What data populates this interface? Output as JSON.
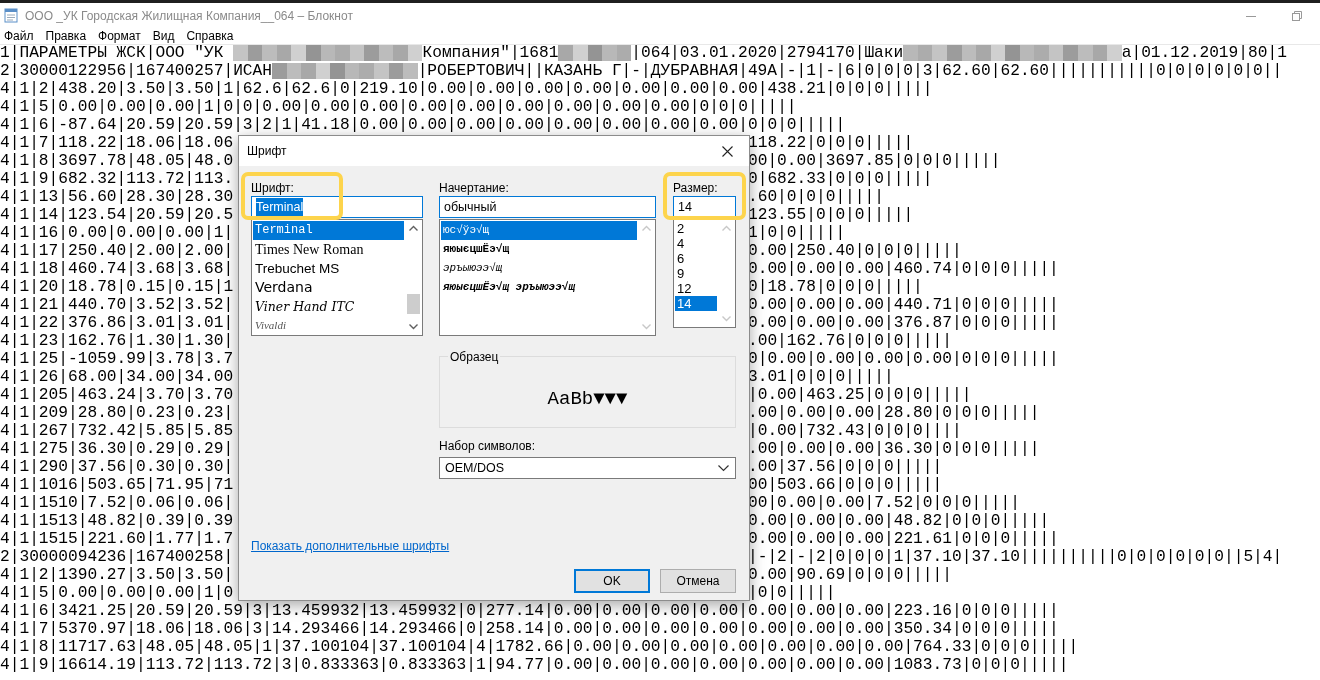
{
  "window": {
    "title": "ООО _УК Городская Жилищная Компания__064 – Блокнот",
    "menu": [
      "Файл",
      "Правка",
      "Формат",
      "Вид",
      "Справка"
    ]
  },
  "document": {
    "lines": [
      {
        "kind": "masked",
        "parts": [
          {
            "kind": "text",
            "text": "1|ПАРАМЕТРЫ ЖСК|ООО \"УК "
          },
          {
            "kind": "redacted"
          },
          {
            "kind": "text",
            "text": "Компания\"|1681"
          },
          {
            "kind": "redacted"
          },
          {
            "kind": "text",
            "text": "|064|03.01.2020|2794170|Шаки"
          },
          {
            "kind": "redacted"
          },
          {
            "kind": "text",
            "text": "а|01.12.2019|80|1"
          }
        ]
      },
      {
        "kind": "masked",
        "parts": [
          {
            "kind": "text",
            "text": "2|30000122956|167400257|ИСАН"
          },
          {
            "kind": "redacted"
          },
          {
            "kind": "text",
            "text": "|РОБЕРТОВИЧ||КАЗАНЬ Г|-|ДУБРАВНАЯ|49А|-|1|-|6|0|0|0|3|62.60|62.60|||||||||||0|0|0|0|0|0||"
          }
        ]
      },
      {
        "kind": "full",
        "text": "4|1|2|438.20|3.50|3.50|1|62.6|62.6|0|219.10|0.00|0.00|0.00|0.00|0.00|0.00|0.00|438.21|0|0|0|||||"
      },
      {
        "kind": "full",
        "text": "4|1|5|0.00|0.00|0.00|1|0|0|0.00|0.00|0.00|0.00|0.00|0.00|0.00|0.00|0.00|0|0|0|||||"
      },
      {
        "kind": "full",
        "text": "4|1|6|-87.64|20.59|20.59|3|2|1|41.18|0.00|0.00|0.00|0.00|0.00|0.00|0.00|0.00|0|0|0|||||"
      },
      {
        "kind": "split",
        "left": "4|1|7|118.22|18.06|18.06",
        "right": "118.22|0|0|0|||||"
      },
      {
        "kind": "split",
        "left": "4|1|8|3697.78|48.05|48.0",
        "right": "00|0.00|3697.85|0|0|0|||||"
      },
      {
        "kind": "split",
        "left": "4|1|9|682.32|113.72|113.",
        "right": "0|682.33|0|0|0|||||"
      },
      {
        "kind": "split",
        "left": "4|1|13|56.60|28.30|28.30",
        "right": ".60|0|0|0|||||"
      },
      {
        "kind": "split",
        "left": "4|1|14|123.54|20.59|20.5",
        "right": "123.55|0|0|0|||||"
      },
      {
        "kind": "split",
        "left": "4|1|16|0.00|0.00|0.00|1|",
        "right": "1|0|0|||||"
      },
      {
        "kind": "split",
        "left": "4|1|17|250.40|2.00|2.00|",
        "right": "0.00|250.40|0|0|0|||||"
      },
      {
        "kind": "split",
        "left": "4|1|18|460.74|3.68|3.68|",
        "right": "0.00|0.00|0.00|460.74|0|0|0|||||"
      },
      {
        "kind": "split",
        "left": "4|1|20|18.78|0.15|0.15|1",
        "right": "0|18.78|0|0|0|||||"
      },
      {
        "kind": "split",
        "left": "4|1|21|440.70|3.52|3.52|",
        "right": "0.00|0.00|0.00|440.71|0|0|0|||||"
      },
      {
        "kind": "split",
        "left": "4|1|22|376.86|3.01|3.01|",
        "right": "0.00|0.00|0.00|376.87|0|0|0|||||"
      },
      {
        "kind": "split",
        "left": "4|1|23|162.76|1.30|1.30|",
        "right": ".00|162.76|0|0|0|||||"
      },
      {
        "kind": "split",
        "left": "4|1|25|-1059.99|3.78|3.7",
        "right": "0|0.00|0.00|0.00|0.00|0|0|0|||||"
      },
      {
        "kind": "split",
        "left": "4|1|26|68.00|34.00|34.00",
        "right": "3.01|0|0|0|||||"
      },
      {
        "kind": "split",
        "left": "4|1|205|463.24|3.70|3.70",
        "right": "|0.00|463.25|0|0|0|||||"
      },
      {
        "kind": "split",
        "left": "4|1|209|28.80|0.23|0.23|",
        "right": ".00|0.00|0.00|28.80|0|0|0|||||"
      },
      {
        "kind": "split",
        "left": "4|1|267|732.42|5.85|5.85",
        "right": "|0.00|732.43|0|0|0||||"
      },
      {
        "kind": "split",
        "left": "4|1|275|36.30|0.29|0.29|",
        "right": ".00|0.00|0.00|36.30|0|0|0|||||"
      },
      {
        "kind": "split",
        "left": "4|1|290|37.56|0.30|0.30|",
        "right": ".00|37.56|0|0|0|||||"
      },
      {
        "kind": "split",
        "left": "4|1|1016|503.65|71.95|71",
        "right": "00|503.66|0|0|0|||||"
      },
      {
        "kind": "split",
        "left": "4|1|1510|7.52|0.06|0.06|",
        "right": "00|0.00|0.00|7.52|0|0|0|||||"
      },
      {
        "kind": "split",
        "left": "4|1|1513|48.82|0.39|0.39",
        "right": "0.00|0.00|0.00|48.82|0|0|0|||||"
      },
      {
        "kind": "split",
        "left": "4|1|1515|221.60|1.77|1.7",
        "right": "0.00|0.00|0.00|221.61|0|0|0|||||"
      },
      {
        "kind": "split",
        "left": "2|30000094236|167400258|",
        "right": "|-|2|-|2|0|0|0|1|37.10|37.10||||||||||0|0|0|0|0|0||5|4|"
      },
      {
        "kind": "split",
        "left": "4|1|2|1390.27|3.50|3.50|",
        "right": "0.00|90.69|0|0|0|||||"
      },
      {
        "kind": "split",
        "left": "4|1|5|0.00|0.00|0.00|1|0",
        "right": "|0|0|||||"
      },
      {
        "kind": "full",
        "text": "4|1|6|3421.25|20.59|20.59|3|13.459932|13.459932|0|277.14|0.00|0.00|0.00|0.00|0.00|0.00|0.00|223.16|0|0|0|||||"
      },
      {
        "kind": "full",
        "text": "4|1|7|5370.97|18.06|18.06|3|14.293466|14.293466|0|258.14|0.00|0.00|0.00|0.00|0.00|0.00|0.00|350.34|0|0|0|||||"
      },
      {
        "kind": "full",
        "text": "4|1|8|11717.63|48.05|48.05|1|37.100104|37.100104|4|1782.66|0.00|0.00|0.00|0.00|0.00|0.00|0.00|764.33|0|0|0|||||"
      },
      {
        "kind": "full",
        "text": "4|1|9|16614.19|113.72|113.72|3|0.833363|0.833363|1|94.77|0.00|0.00|0.00|0.00|0.00|0.00|0.00|1083.73|0|0|0|||||"
      }
    ]
  },
  "font_dialog": {
    "title": "Шрифт",
    "font": {
      "label": "Шрифт:",
      "value": "Terminal",
      "value_selected": true,
      "highlighted": true,
      "scrollable": true,
      "items": [
        {
          "label": "Terminal",
          "kind": "mono",
          "selected": true
        },
        {
          "label": "Times New Roman",
          "kind": "serif",
          "selected": false
        },
        {
          "label": "Trebuchet MS",
          "kind": "humanist",
          "selected": false
        },
        {
          "label": "Verdana",
          "kind": "wide",
          "selected": false
        },
        {
          "label": "Viner Hand ITC",
          "kind": "script",
          "selected": false
        },
        {
          "label": "Vivaldi",
          "kind": "ornate",
          "selected": false
        }
      ]
    },
    "style": {
      "label": "Начертание:",
      "value": "обычный",
      "value_selected": false,
      "highlighted": false,
      "scrollable": false,
      "items": [
        {
          "label": "юс√ўэ√щ",
          "kind": "regular",
          "selected": true
        },
        {
          "label": "яюыєцшЁэ√щ",
          "kind": "bold",
          "selected": false
        },
        {
          "label": "эръыюээ√щ",
          "kind": "italic",
          "selected": false
        },
        {
          "label": "яюыєцшЁэ√щ эръыюээ√щ",
          "kind": "bold-italic",
          "selected": false
        }
      ]
    },
    "size": {
      "label": "Размер:",
      "value": "14",
      "value_selected": false,
      "highlighted": true,
      "scrollable": false,
      "items": [
        {
          "label": "2",
          "selected": false
        },
        {
          "label": "4",
          "selected": false
        },
        {
          "label": "6",
          "selected": false
        },
        {
          "label": "9",
          "selected": false
        },
        {
          "label": "12",
          "selected": false
        },
        {
          "label": "14",
          "selected": true
        }
      ]
    },
    "sample": {
      "label": "Образец",
      "text": "AaBb▼▼▼"
    },
    "charset": {
      "label": "Набор символов:",
      "value": "OEM/DOS"
    },
    "link": "Показать дополнительные шрифты",
    "buttons": [
      {
        "label": "OK",
        "default": true
      },
      {
        "label": "Отмена",
        "default": false
      }
    ]
  }
}
